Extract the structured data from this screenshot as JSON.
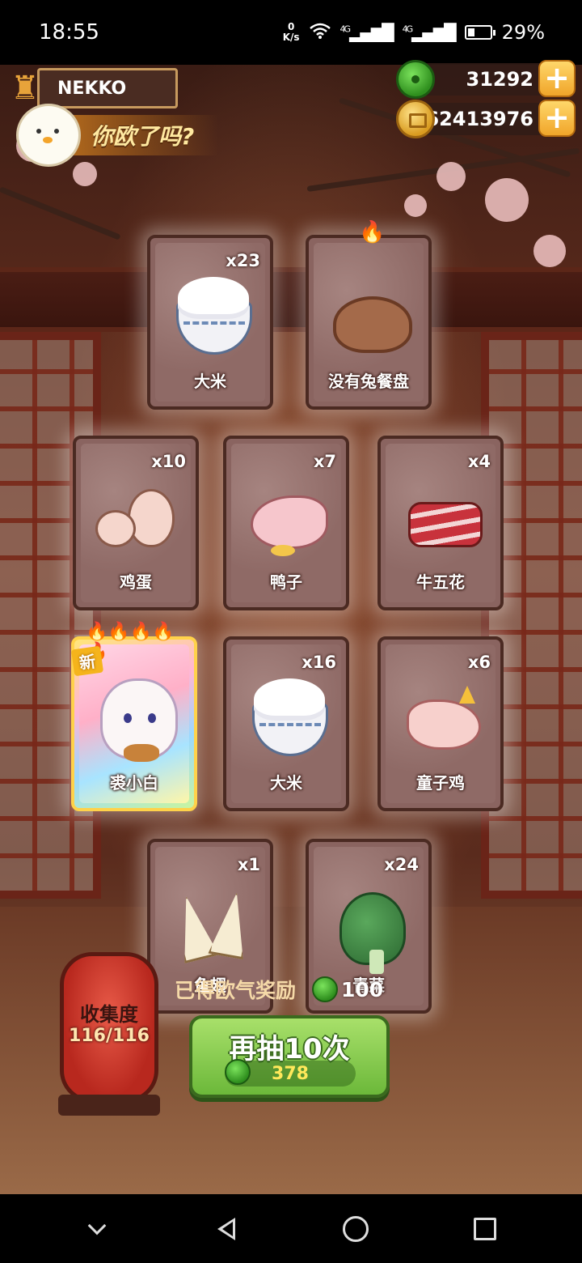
{
  "status_bar": {
    "time": "18:55",
    "net_speed_value": "0",
    "net_speed_unit": "K/s",
    "signal1": "4G",
    "signal2": "4G",
    "battery": "29%"
  },
  "player": {
    "name": "NEKKO"
  },
  "currencies": {
    "jade": "31292",
    "coins": "62413976",
    "plus": "+"
  },
  "banner": {
    "text": "你欧了吗?"
  },
  "cards": [
    {
      "label": "大米",
      "count": "x23",
      "art": "rice-bowl"
    },
    {
      "label": "没有兔餐盘",
      "count": "",
      "art": "plate",
      "fire": "🔥"
    },
    {
      "label": "鸡蛋",
      "count": "x10",
      "art": "egg"
    },
    {
      "label": "鸭子",
      "count": "x7",
      "art": "duck"
    },
    {
      "label": "牛五花",
      "count": "x4",
      "art": "pork"
    },
    {
      "label": "裘小白",
      "count": "",
      "art": "cat",
      "badge": "新",
      "fire": "🔥🔥🔥🔥🔥"
    },
    {
      "label": "大米",
      "count": "x16",
      "art": "rice-bowl"
    },
    {
      "label": "童子鸡",
      "count": "x6",
      "art": "chicken"
    },
    {
      "label": "鱼翅",
      "count": "x1",
      "art": "shark-fin"
    },
    {
      "label": "青菜",
      "count": "x24",
      "art": "greens"
    }
  ],
  "collection": {
    "title": "收集度",
    "value": "116/116"
  },
  "reward": {
    "label": "已得欧气奖励",
    "value": "100"
  },
  "draw_button": {
    "label": "再抽10次",
    "cost": "378"
  },
  "colors": {
    "accent_green": "#6cb83a",
    "gold": "#f0a52a",
    "lantern_red": "#b8281e"
  }
}
